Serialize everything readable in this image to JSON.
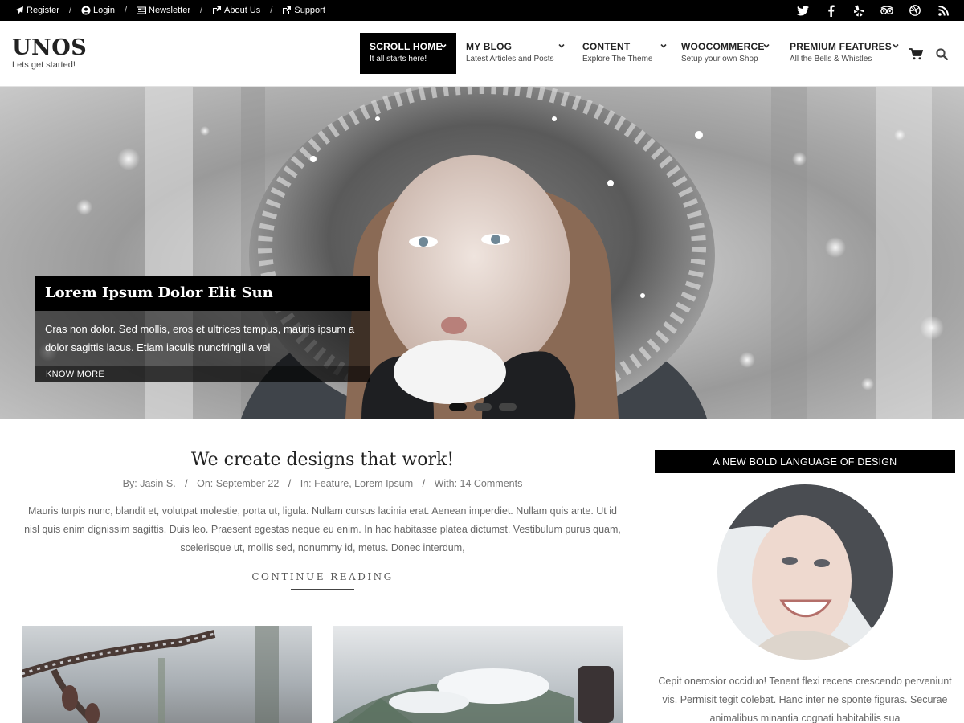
{
  "topbar": {
    "links": [
      {
        "label": "Register",
        "icon": "paper-plane-icon"
      },
      {
        "label": "Login",
        "icon": "user-icon"
      },
      {
        "label": "Newsletter",
        "icon": "newspaper-icon"
      },
      {
        "label": "About Us",
        "icon": "external-link-icon"
      },
      {
        "label": "Support",
        "icon": "external-link-icon"
      }
    ],
    "separator": "/",
    "social": [
      "twitter-icon",
      "facebook-icon",
      "yelp-icon",
      "tripadvisor-icon",
      "dribbble-icon",
      "rss-icon"
    ]
  },
  "header": {
    "logo": "UNOS",
    "tagline": "Lets get started!",
    "nav": [
      {
        "title": "SCROLL HOME",
        "sub": "It all starts here!",
        "active": true
      },
      {
        "title": "MY BLOG",
        "sub": "Latest Articles and Posts"
      },
      {
        "title": "CONTENT",
        "sub": "Explore The Theme"
      },
      {
        "title": "WOOCOMMERCE",
        "sub": "Setup your own Shop"
      },
      {
        "title": "PREMIUM FEATURES",
        "sub": "All the Bells & Whistles"
      }
    ],
    "tools": [
      "cart-icon",
      "search-icon"
    ]
  },
  "hero": {
    "title": "Lorem Ipsum Dolor Elit Sun",
    "text": "Cras non dolor. Sed mollis, eros et ultrices tempus, mauris ipsum a dolor sagittis lacus. Etiam iaculis nuncfringilla vel",
    "button": "KNOW MORE",
    "slides": 3,
    "active_slide": 1
  },
  "post": {
    "title": "We create designs that work!",
    "meta": {
      "by_label": "By:",
      "author": "Jasin S.",
      "on_label": "On:",
      "date": "September 22",
      "in_label": "In:",
      "categories": "Feature, Lorem Ipsum",
      "with_label": "With:",
      "comments": "14 Comments",
      "separator": "/"
    },
    "excerpt": "Mauris turpis nunc, blandit et, volutpat molestie, porta ut, ligula. Nullam cursus lacinia erat. Aenean imperdiet. Nullam quis ante. Ut id nisl quis enim dignissim sagittis. Duis leo. Praesent egestas neque eu enim. In hac habitasse platea dictumst. Vestibulum purus quam, scelerisque ut, mollis sed, nonummy id, metus. Donec interdum,",
    "continue": "CONTINUE READING"
  },
  "sidebar": {
    "widget_title": "A NEW BOLD LANGUAGE OF DESIGN",
    "text": "Cepit onerosior occiduo! Tenent flexi recens crescendo perveniunt vis. Permisit tegit colebat. Hanc inter ne sponte figuras. Securae animalibus minantia cognati habitabilis sua"
  },
  "colors": {
    "topbar_bg": "#000000",
    "accent": "#000000",
    "text_muted": "#666666"
  }
}
